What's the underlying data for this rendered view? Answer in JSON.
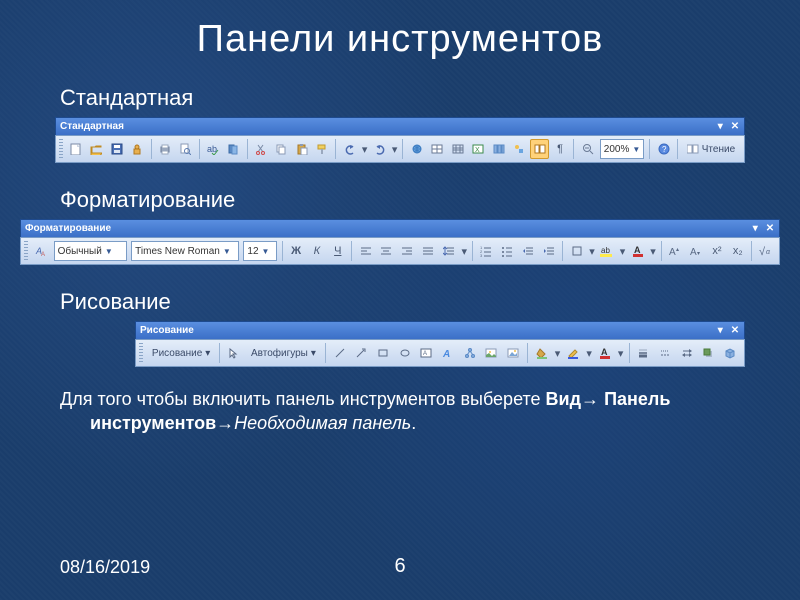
{
  "title": "Панели инструментов",
  "section1": "Стандартная",
  "section2": "Форматирование",
  "section3": "Рисование",
  "note_parts": {
    "prefix": "Для того чтобы включить панель инструментов выберете ",
    "bold1": "Вид",
    "arrow": "→ ",
    "bold2": "Панель инструментов",
    "arrow2": "→",
    "italic": "Необходимая панель",
    "period": "."
  },
  "footer_date": "08/16/2019",
  "footer_page": "6",
  "tb_standard": {
    "titlebar": "Стандартная",
    "zoom": "200%",
    "reading": "Чтение"
  },
  "tb_format": {
    "titlebar": "Форматирование",
    "style_label": "Обычный",
    "font": "Times New Roman",
    "size": "12",
    "bold": "Ж",
    "italic": "К",
    "underline": "Ч",
    "xsup": "x²",
    "xsub": "x₂"
  },
  "tb_draw": {
    "titlebar": "Рисование",
    "menu": "Рисование",
    "autoshapes": "Автофигуры"
  }
}
